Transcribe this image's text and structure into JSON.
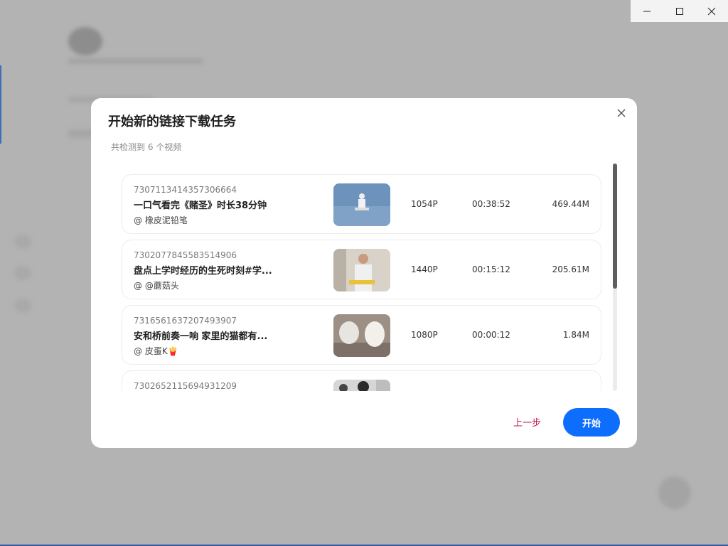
{
  "dialog": {
    "title": "开始新的链接下载任务",
    "subtitle": "共检测到 6 个视频",
    "prev_label": "上一步",
    "start_label": "开始"
  },
  "videos": [
    {
      "id": "7307113414357306664",
      "title": "一口气看完《赌圣》时长38分钟",
      "author": "@ 橡皮泥铅笔",
      "resolution": "1054P",
      "duration": "00:38:52",
      "size": "469.44M"
    },
    {
      "id": "7302077845583514906",
      "title": "盘点上学时经历的生死时刻#学...",
      "author": "@ @蘑菇头",
      "resolution": "1440P",
      "duration": "00:15:12",
      "size": "205.61M"
    },
    {
      "id": "7316561637207493907",
      "title": "安和桥前奏一响 家里的猫都有...",
      "author": "@ 皮蛋K🍟",
      "resolution": "1080P",
      "duration": "00:00:12",
      "size": "1.84M"
    },
    {
      "id": "7302652115694931209",
      "title": "",
      "author": "",
      "resolution": "",
      "duration": "",
      "size": ""
    }
  ],
  "colors": {
    "primary": "#0d6efd",
    "prev_text": "#c2185b",
    "overlay": "#b3b3b3"
  }
}
